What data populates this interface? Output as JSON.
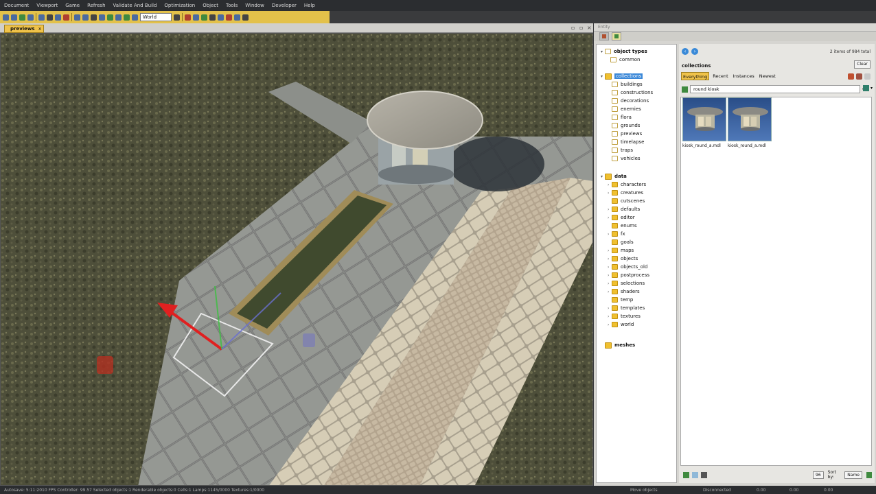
{
  "menu": [
    "Document",
    "Viewport",
    "Game",
    "Refresh",
    "Validate And Build",
    "Optimization",
    "Object",
    "Tools",
    "Window",
    "Developer",
    "Help"
  ],
  "toolbar": {
    "space_combo": "World"
  },
  "document_tab": {
    "label": "previews",
    "close": "x"
  },
  "panel": {
    "title": "Entity",
    "tree": {
      "object_types": "object types",
      "common": "common",
      "collections": "collections",
      "collection_items": [
        "buildings",
        "constructions",
        "decorations",
        "enemies",
        "flora",
        "grounds",
        "previews",
        "timelapse",
        "traps",
        "vehicles"
      ],
      "data": "data",
      "data_items": [
        "characters",
        "creatures",
        "cutscenes",
        "defaults",
        "editor",
        "enums",
        "fx",
        "goals",
        "maps",
        "objects",
        "objects_old",
        "postprocess",
        "selections",
        "shaders",
        "temp",
        "templates",
        "textures",
        "world"
      ],
      "meshes": "meshes"
    },
    "browser": {
      "count_text": "2 items of 984 total",
      "breadcrumb": "collections",
      "clear_label": "Clear",
      "filter_tabs": [
        "Everything",
        "Recent",
        "Instances",
        "Newest"
      ],
      "search_value": "round kiosk",
      "results": [
        {
          "name": "kiosk_round_a.mdl"
        },
        {
          "name": "kiosk_round_a.mdl"
        }
      ],
      "view_size": "96",
      "sort_label": "Sort by:",
      "sort_value": "Name"
    }
  },
  "statusbar": {
    "left_text": "Autosave: 5:11:2010   FPS Controller: 99.57   Selected objects:1   Renderable objects:0   Cells:1   Lamps:1145/0000   Textures:1/0000",
    "center_text": "Move objects",
    "conn_text": "Disconnected",
    "v1": "0.00",
    "v2": "0.00",
    "v3": "0.00"
  },
  "colors": {
    "accent": "#f0c34a",
    "selection": "#3b88d8",
    "menubar": "#2b2d30"
  }
}
